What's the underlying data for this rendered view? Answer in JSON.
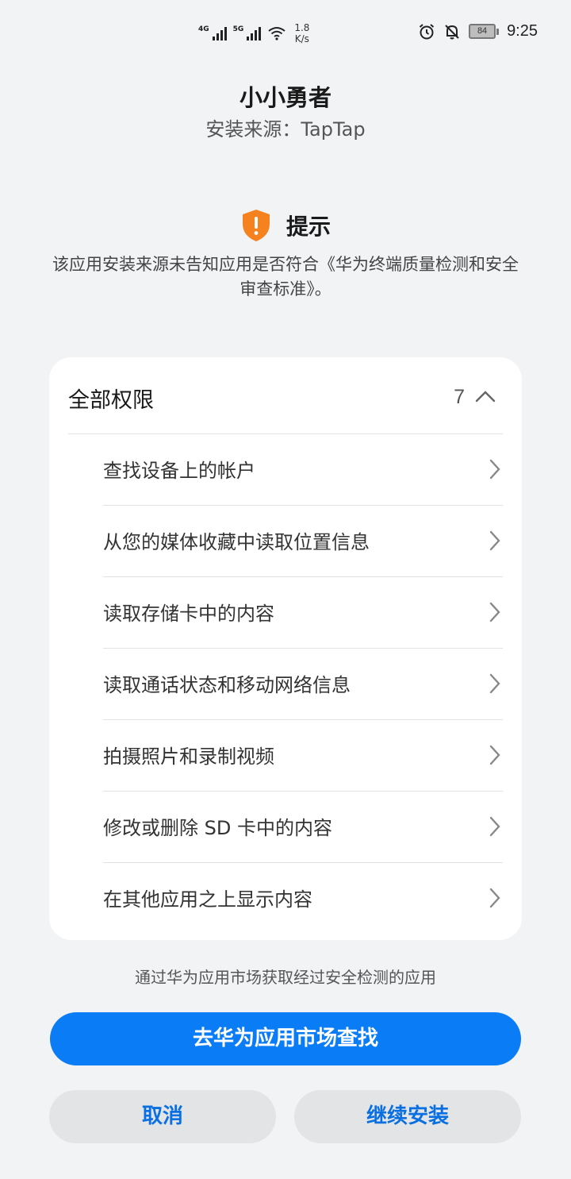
{
  "status_bar": {
    "sig1_tag": "4G",
    "sig2_tag": "5G",
    "speed_value": "1.8",
    "speed_unit": "K/s",
    "battery": "84",
    "time": "9:25",
    "icons": [
      "signal-icon",
      "wifi-icon",
      "alarm-icon",
      "mute-bell-icon",
      "battery-icon"
    ]
  },
  "app": {
    "name": "小小勇者",
    "source": "安装来源：TapTap"
  },
  "tip": {
    "title": "提示",
    "text": "该应用安装来源未告知应用是否符合《华为终端质量检测和安全审查标准》。",
    "icon_color": "#f5821f"
  },
  "permissions": {
    "title": "全部权限",
    "count": "7",
    "items": [
      "查找设备上的帐户",
      "从您的媒体收藏中读取位置信息",
      "读取存储卡中的内容",
      "读取通话状态和移动网络信息",
      "拍摄照片和录制视频",
      "修改或删除 SD 卡中的内容",
      "在其他应用之上显示内容"
    ]
  },
  "footer": {
    "hint": "通过华为应用市场获取经过安全检测的应用",
    "primary_button": "去华为应用市场查找",
    "cancel_button": "取消",
    "continue_button": "继续安装",
    "accent_color": "#0a7cf5"
  }
}
